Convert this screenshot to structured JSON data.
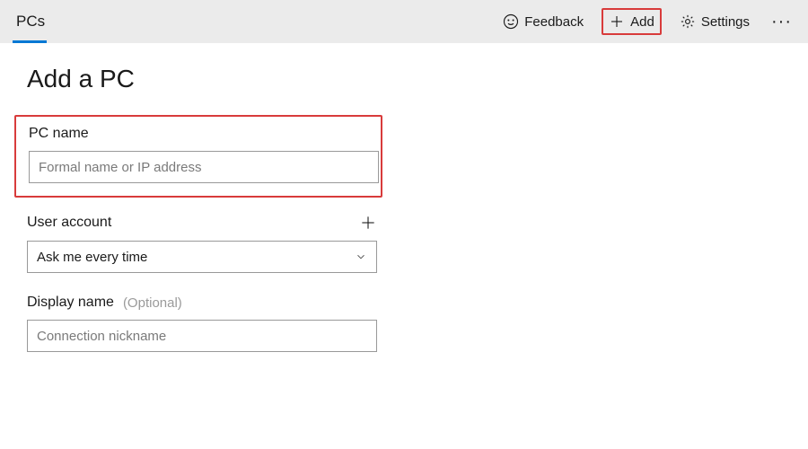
{
  "header": {
    "tab": "PCs",
    "feedback": "Feedback",
    "add": "Add",
    "settings": "Settings"
  },
  "page": {
    "title": "Add a PC"
  },
  "fields": {
    "pc_name_label": "PC name",
    "pc_name_placeholder": "Formal name or IP address",
    "user_account_label": "User account",
    "user_account_value": "Ask me every time",
    "display_name_label": "Display name",
    "display_name_optional": "(Optional)",
    "display_name_placeholder": "Connection nickname"
  }
}
